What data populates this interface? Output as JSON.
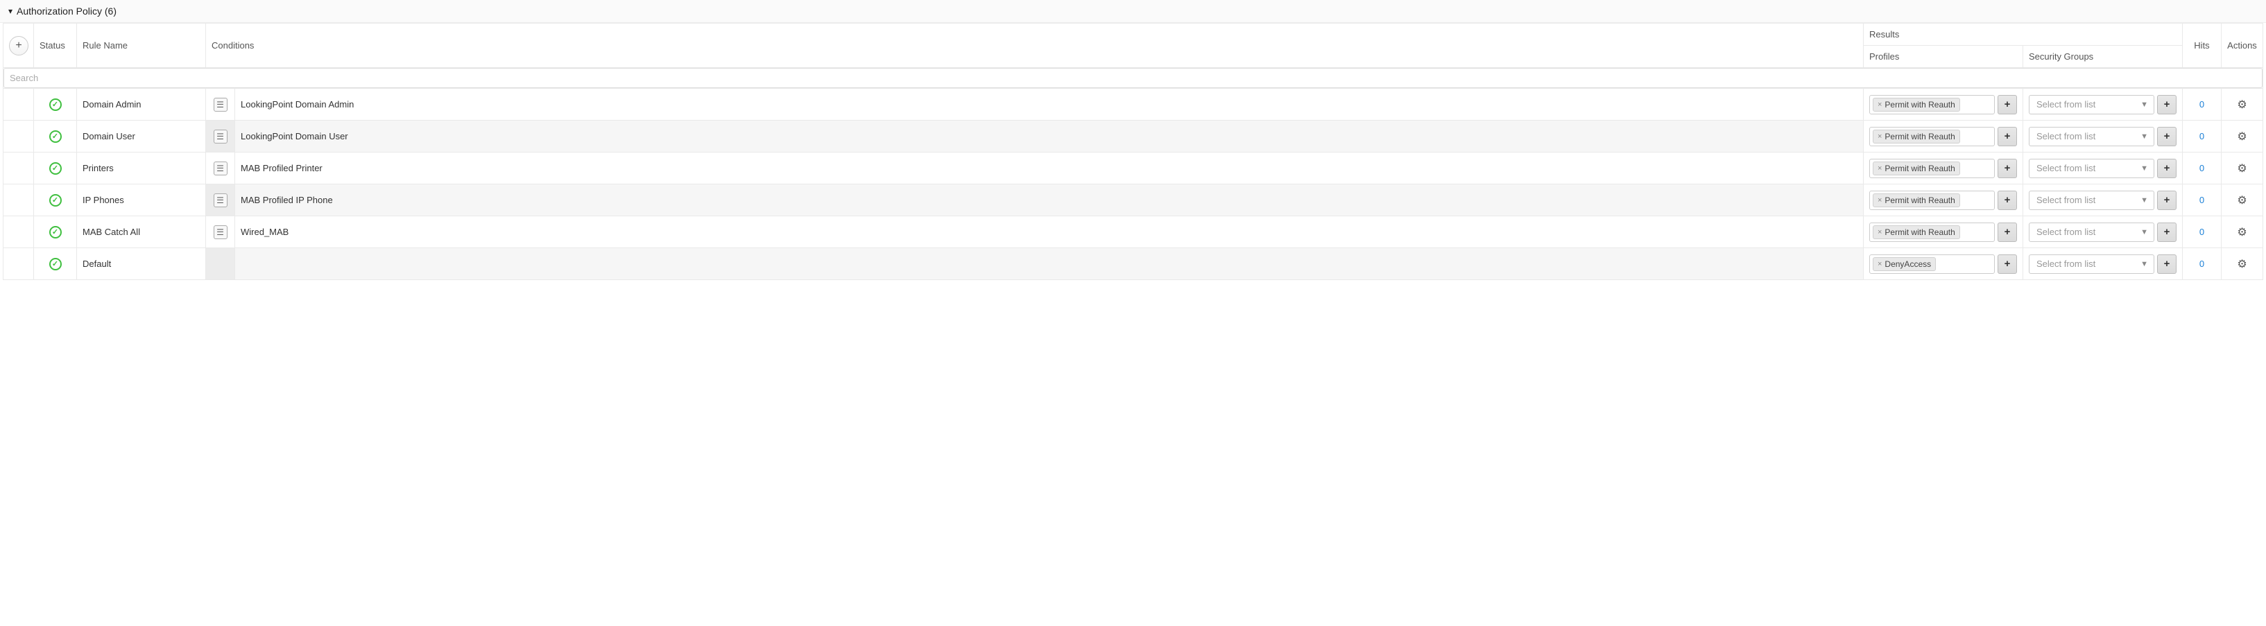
{
  "panel": {
    "title": "Authorization Policy (6)"
  },
  "headers": {
    "status": "Status",
    "ruleName": "Rule Name",
    "conditions": "Conditions",
    "results": "Results",
    "profiles": "Profiles",
    "securityGroups": "Security Groups",
    "hits": "Hits",
    "actions": "Actions"
  },
  "search": {
    "placeholder": "Search"
  },
  "common": {
    "sgPlaceholder": "Select from list"
  },
  "rows": [
    {
      "name": "Domain Admin",
      "condition": "LookingPoint Domain Admin",
      "hasConditionIcon": true,
      "profileTag": "Permit with Reauth",
      "hits": "0"
    },
    {
      "name": "Domain User",
      "condition": "LookingPoint Domain User",
      "hasConditionIcon": true,
      "profileTag": "Permit with Reauth",
      "hits": "0"
    },
    {
      "name": "Printers",
      "condition": "MAB Profiled Printer",
      "hasConditionIcon": true,
      "profileTag": "Permit with Reauth",
      "hits": "0"
    },
    {
      "name": "IP Phones",
      "condition": "MAB Profiled IP Phone",
      "hasConditionIcon": true,
      "profileTag": "Permit with Reauth",
      "hits": "0"
    },
    {
      "name": "MAB Catch All",
      "condition": "Wired_MAB",
      "hasConditionIcon": true,
      "profileTag": "Permit with Reauth",
      "hits": "0"
    },
    {
      "name": "Default",
      "condition": "",
      "hasConditionIcon": false,
      "profileTag": "DenyAccess",
      "hits": "0"
    }
  ]
}
